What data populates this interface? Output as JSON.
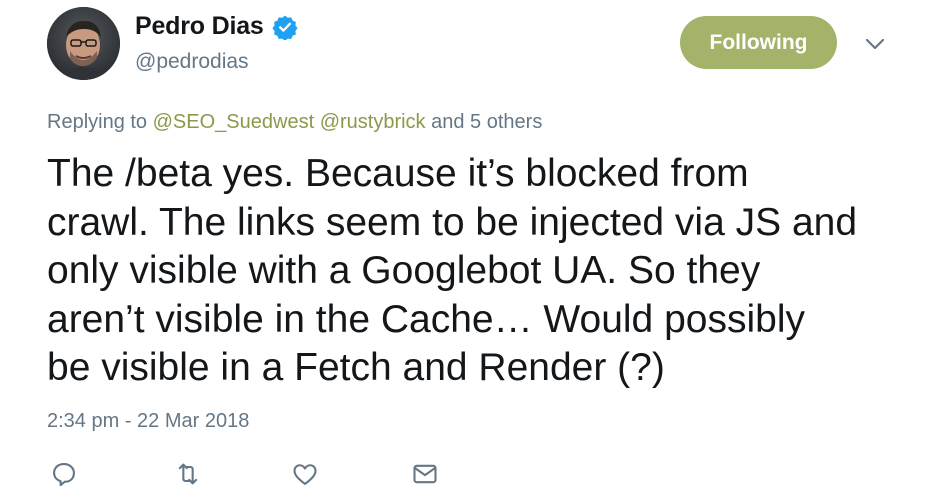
{
  "author": {
    "name": "Pedro Dias",
    "handle": "@pedrodias",
    "verified": true
  },
  "follow_button": {
    "label": "Following",
    "color": "#a3b36a"
  },
  "reply_context": {
    "prefix": "Replying to",
    "mentions": [
      "@SEO_Suedwest",
      "@rustybrick"
    ],
    "suffix": "and 5 others",
    "mention_color": "#8a9a4a"
  },
  "tweet": {
    "lines": [
      "The /beta yes. Because it’s blocked from",
      "crawl. The links seem to be injected via JS and",
      "only visible with a Googlebot UA. So they",
      "aren’t visible in the Cache… Would possibly",
      "be visible in a Fetch and Render (?)"
    ],
    "timestamp": "2:34 pm - 22 Mar 2018"
  },
  "actions": [
    {
      "name": "reply-icon"
    },
    {
      "name": "retweet-icon"
    },
    {
      "name": "like-icon"
    },
    {
      "name": "direct-message-icon"
    }
  ]
}
